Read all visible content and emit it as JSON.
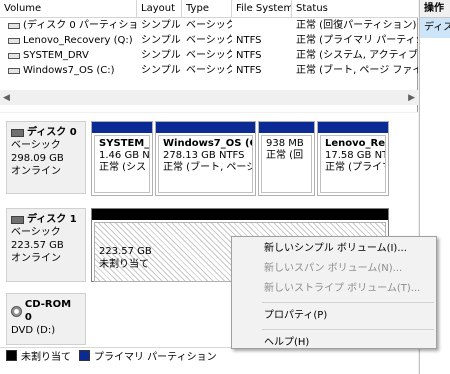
{
  "columns": [
    "Volume",
    "Layout",
    "Type",
    "File System",
    "Status"
  ],
  "volumes": [
    {
      "volume": "(ディスク 0 パーティション 3)",
      "layout": "シンプル",
      "type": "ベーシック",
      "fs": "",
      "status": "正常 (回復パーティション)"
    },
    {
      "volume": "Lenovo_Recovery (Q:)",
      "layout": "シンプル",
      "type": "ベーシック",
      "fs": "NTFS",
      "status": "正常 (プライマリ パーティション"
    },
    {
      "volume": "SYSTEM_DRV",
      "layout": "シンプル",
      "type": "ベーシック",
      "fs": "NTFS",
      "status": "正常 (システム, アクティブ, プラ"
    },
    {
      "volume": "Windows7_OS (C:)",
      "layout": "シンプル",
      "type": "ベーシック",
      "fs": "NTFS",
      "status": "正常 (ブート, ページ ファイル, ク"
    }
  ],
  "actions": {
    "title": "操作",
    "item": "ディスク"
  },
  "disks": [
    {
      "name": "ディスク 0",
      "type": "ベーシック",
      "size": "298.09 GB",
      "state": "オンライン"
    },
    {
      "name": "ディスク 1",
      "type": "ベーシック",
      "size": "223.57 GB",
      "state": "オンライン"
    },
    {
      "name": "CD-ROM 0",
      "type": "DVD (D:)",
      "size": "",
      "state": "メディアなし"
    }
  ],
  "partitions": [
    {
      "title": "SYSTEM_D",
      "size": "1.46 GB NTFS",
      "status": "正常 (シス"
    },
    {
      "title": "Windows7_OS  (C:)",
      "size": "278.13 GB NTFS",
      "status": "正常 (ブート, ページ ファ"
    },
    {
      "title": "",
      "size": "938 MB",
      "status": "正常 (回"
    },
    {
      "title": "Lenovo_Recove",
      "size": "17.58 GB NTFS",
      "status": "正常 (プライマリ"
    }
  ],
  "unallocated": {
    "size": "223.57 GB",
    "label": "未割り当て"
  },
  "legend": {
    "unallocated": "未割り当て",
    "primary": "プライマリ パーティション",
    "colors": {
      "unallocated": "#000000",
      "primary": "#0b2a93"
    }
  },
  "menu": {
    "new_simple": "新しいシンプル ボリューム(I)...",
    "new_spanned": "新しいスパン ボリューム(N)...",
    "new_striped": "新しいストライプ ボリューム(T)...",
    "properties": "プロパティ(P)",
    "help": "ヘルプ(H)"
  }
}
